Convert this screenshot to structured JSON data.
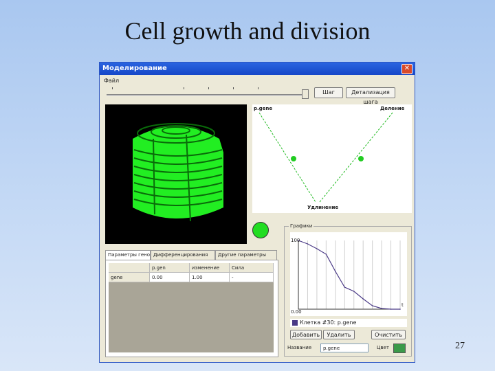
{
  "slide": {
    "title": "Cell growth and division",
    "page_number": "27"
  },
  "window": {
    "title": "Моделирование",
    "close_glyph": "✕",
    "menu": {
      "file": "Файл"
    },
    "toolbar": {
      "step_label": "Шаг",
      "detail_label": "Детализация шага"
    },
    "diagram": {
      "top_left": "p.gene",
      "top_right": "Деление",
      "bottom": "Удлинение"
    },
    "tabs": [
      {
        "label": "Параметры генов"
      },
      {
        "label": "Дифференцирования"
      },
      {
        "label": "Другие параметры"
      }
    ],
    "table": {
      "headers": [
        "",
        "p.gen",
        "изменение",
        "Сила"
      ],
      "rows": [
        [
          "gene",
          "0.00",
          "1.00",
          "-"
        ]
      ]
    },
    "graphs": {
      "group_label": "Графики",
      "y_max_label": "100",
      "y_min_label": "0.00",
      "x_end_label": "t",
      "legend_text": "Клетка #30: p.gene",
      "add_button": "Добавить",
      "remove_button": "Удалить",
      "clear_button": "Очистить",
      "name_label": "Название",
      "name_value": "p.gene",
      "color_label": "Цвет"
    }
  },
  "colors": {
    "accent_green": "#22ee22",
    "line_color": "#4a3a86",
    "window_title": "#1f5ad6"
  },
  "chart_data": {
    "type": "line",
    "series": [
      {
        "values": [
          100,
          95,
          88,
          80,
          55,
          32,
          26,
          15,
          5,
          1,
          0,
          0
        ]
      }
    ],
    "x": [
      0,
      1,
      2,
      3,
      4,
      5,
      6,
      7,
      8,
      9,
      10,
      11
    ],
    "ylim": [
      0,
      100
    ]
  }
}
